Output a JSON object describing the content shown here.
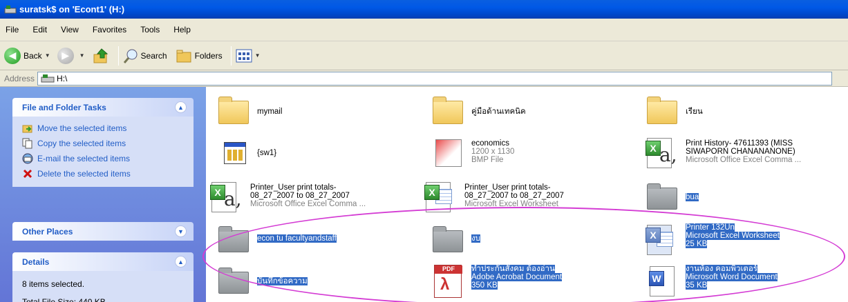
{
  "window": {
    "title": "suratsk$ on 'Econt1' (H:)"
  },
  "menu": [
    "File",
    "Edit",
    "View",
    "Favorites",
    "Tools",
    "Help"
  ],
  "toolbar": {
    "back": "Back",
    "search": "Search",
    "folders": "Folders"
  },
  "address": {
    "label": "Address",
    "value": "H:\\"
  },
  "tasks": {
    "title": "File and Folder Tasks",
    "items": [
      "Move the selected items",
      "Copy the selected items",
      "E-mail the selected items",
      "Delete the selected items"
    ]
  },
  "other": {
    "title": "Other Places"
  },
  "details": {
    "title": "Details",
    "selected": "8 items selected.",
    "size": "Total File Size: 440 KB"
  },
  "files": [
    {
      "name": "mymail",
      "icon": "folder-icon"
    },
    {
      "name": "คู่มือด้านเทคนิค",
      "icon": "folder-icon"
    },
    {
      "name": "เรียน",
      "icon": "folder-icon"
    },
    {
      "name": "{sw1}",
      "icon": "application-icon"
    },
    {
      "name": "economics",
      "l2": "1200 x 1130",
      "l3": "BMP File",
      "icon": "bmp-icon"
    },
    {
      "name": "Print History- 47611393 (MISS",
      "l2": "SIWAPORN CHANANANONE)",
      "l3": "Microsoft Office Excel Comma ...",
      "icon": "excel-csv-icon"
    },
    {
      "name": "Printer_User print totals-",
      "l2": "08_27_2007 to 08_27_2007",
      "l3": "Microsoft Office Excel Comma ...",
      "icon": "excel-csv-icon"
    },
    {
      "name": "Printer_User print totals-",
      "l2": "08_27_2007 to 08_27_2007",
      "l3": "Microsoft Excel Worksheet",
      "icon": "excel-icon"
    },
    {
      "name": "bua",
      "icon": "folder-icon"
    },
    {
      "name": "econ tu facultyandstaff",
      "icon": "folder-icon"
    },
    {
      "name": "งบ",
      "icon": "folder-icon"
    },
    {
      "name": "Printer 132Un",
      "l2": "Microsoft Excel Worksheet",
      "l3": "25 KB",
      "icon": "excel-icon"
    },
    {
      "name": "บันทึกข้อความ",
      "icon": "folder-icon"
    },
    {
      "name": "ทำประกันสังคม ต้องอ่าน",
      "l2": "Adobe Acrobat Document",
      "l3": "350 KB",
      "icon": "pdf-icon"
    },
    {
      "name": "งานห้อง คอมพิวเตอร์",
      "l2": "Microsoft Word Document",
      "l3": "35 KB",
      "icon": "word-icon"
    }
  ]
}
